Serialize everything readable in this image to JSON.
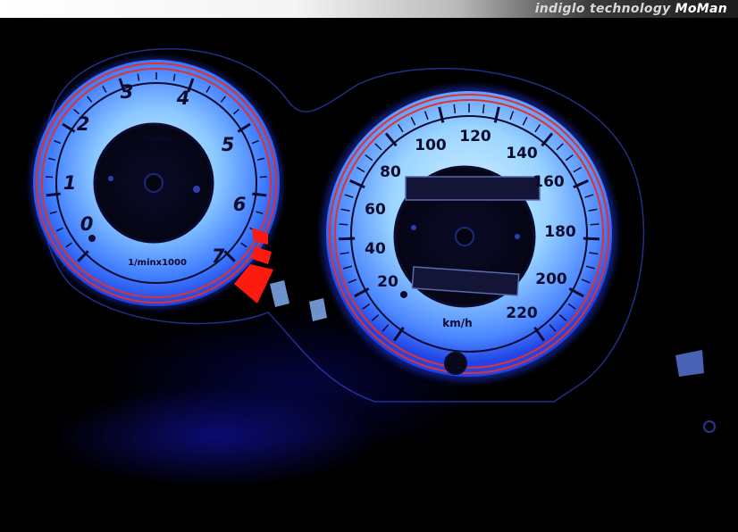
{
  "header": {
    "tagline": "indiglo technology",
    "brand": "MoMan"
  },
  "tachometer": {
    "logo": "MoMan",
    "unit": "1/minx1000",
    "labels": [
      "0",
      "1",
      "2",
      "3",
      "4",
      "5",
      "6",
      "7"
    ]
  },
  "speedometer": {
    "unit": "km/h",
    "labels": [
      "20",
      "40",
      "60",
      "80",
      "100",
      "120",
      "140",
      "160",
      "180",
      "200",
      "220"
    ]
  },
  "colors": {
    "dial_glow": "#2c6cff",
    "dial_face": "#7cc0ff",
    "redline": "#ff1a10",
    "ring": "#e0322a",
    "background": "#000000"
  }
}
